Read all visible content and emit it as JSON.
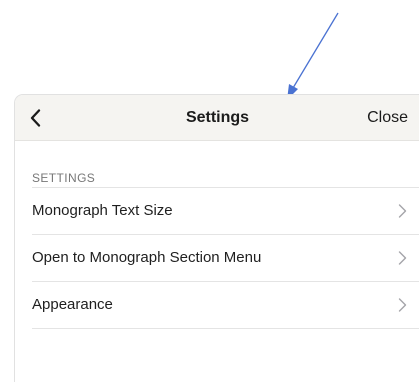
{
  "header": {
    "back_icon": "chevron-left-icon",
    "title": "Settings",
    "close_label": "Close"
  },
  "section": {
    "header": "SETTINGS"
  },
  "items": [
    {
      "label": "Monograph Text Size",
      "icon": "chevron-right-icon"
    },
    {
      "label": "Open to Monograph Section Menu",
      "icon": "chevron-right-icon"
    },
    {
      "label": "Appearance",
      "icon": "chevron-right-icon"
    }
  ],
  "colors": {
    "annotation_arrow": "#4a72d2",
    "navbar_background": "#f5f4f1",
    "chevron": "#a3a3a8"
  }
}
